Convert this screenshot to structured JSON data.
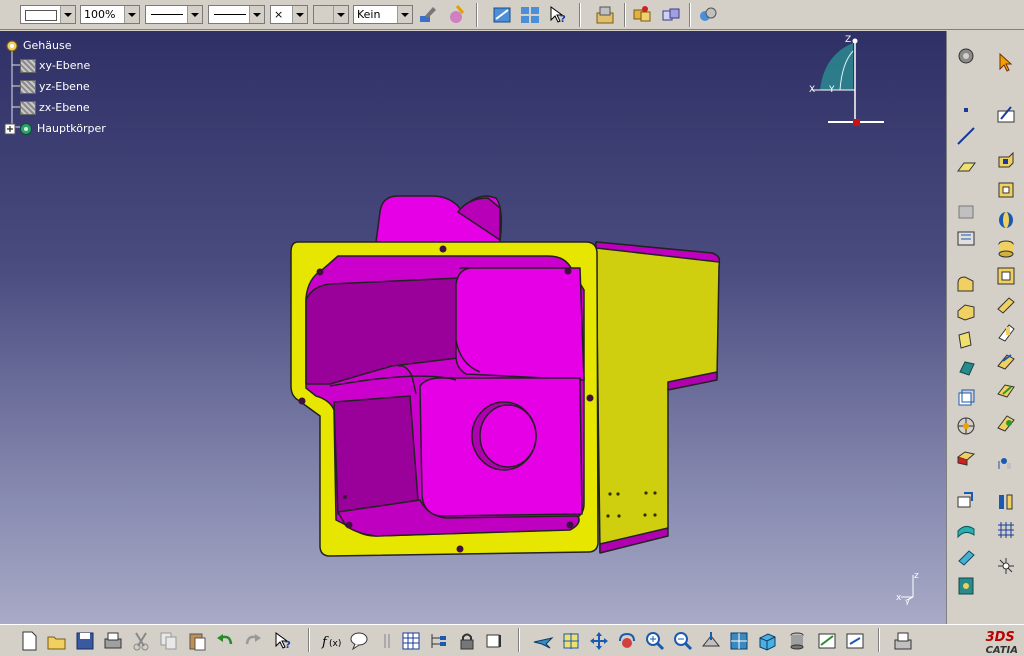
{
  "toolbar": {
    "color_value": "",
    "transparency_value": "100%",
    "line_thickness_value": "",
    "line_type_value": "",
    "point_symbol_value": "×",
    "layer_value": "",
    "layer_filter_value": "Kein"
  },
  "tree": {
    "root": "Gehäuse",
    "items": [
      "xy-Ebene",
      "yz-Ebene",
      "zx-Ebene"
    ],
    "body": "Hauptkörper"
  },
  "compass": {
    "x": "X",
    "y": "Y",
    "z": "Z"
  },
  "axis_triad": {
    "x": "x",
    "y": "y",
    "z": "z"
  },
  "colors": {
    "part_face_magenta": "#e600e6",
    "part_face_yellow": "#e6e600",
    "background_top": "#2f3166",
    "background_bottom": "#a8aac6"
  },
  "status": {
    "product": "CATIA"
  }
}
